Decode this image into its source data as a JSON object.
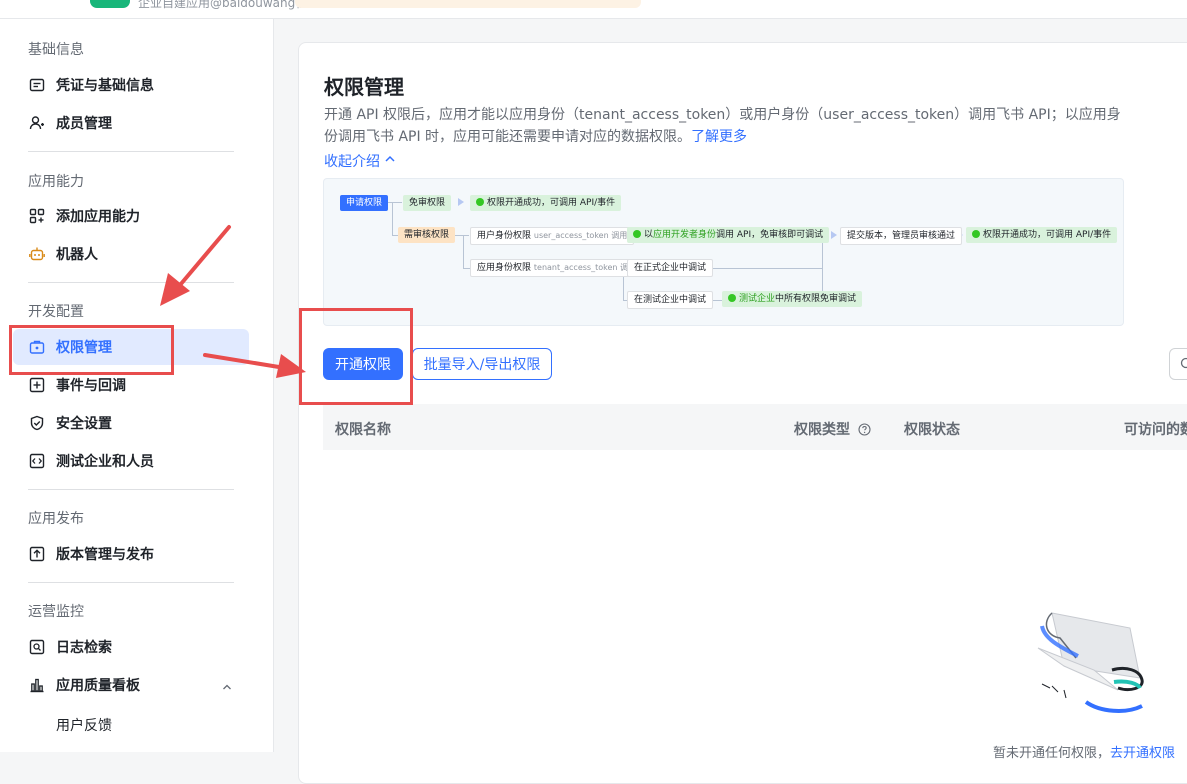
{
  "topbar": {
    "app_subtitle": "企业自建应用@baidouwang社区"
  },
  "sidebar": {
    "sections": [
      {
        "title": "基础信息"
      },
      {
        "title": "应用能力"
      },
      {
        "title": "开发配置"
      },
      {
        "title": "应用发布"
      },
      {
        "title": "运营监控"
      }
    ],
    "items": [
      {
        "label": "凭证与基础信息",
        "icon": "credential-icon"
      },
      {
        "label": "成员管理",
        "icon": "member-add-icon"
      },
      {
        "label": "添加应用能力",
        "icon": "app-grid-icon"
      },
      {
        "label": "机器人",
        "icon": "robot-icon"
      },
      {
        "label": "权限管理",
        "icon": "permission-icon"
      },
      {
        "label": "事件与回调",
        "icon": "event-icon"
      },
      {
        "label": "安全设置",
        "icon": "shield-icon"
      },
      {
        "label": "测试企业和人员",
        "icon": "code-icon"
      },
      {
        "label": "版本管理与发布",
        "icon": "upload-icon"
      },
      {
        "label": "日志检索",
        "icon": "log-search-icon"
      },
      {
        "label": "应用质量看板",
        "icon": "chart-icon"
      },
      {
        "label": "用户反馈"
      }
    ]
  },
  "main": {
    "title": "权限管理",
    "intro_text": "开通 API 权限后，应用才能以应用身份（tenant_access_token）或用户身份（user_access_token）调用飞书 API；以应用身份调用飞书 API 时，应用可能还需要申请对应的数据权限。",
    "learn_more": "了解更多",
    "collapse_label": "收起介绍",
    "flow": {
      "apply": "申请权限",
      "free": "免审权限",
      "review": "需审核权限",
      "success_short": "权限开通成功，可调用 API/事件",
      "user_identity": "用户身份权限",
      "user_token": "user_access_token 调用",
      "app_dev_prefix": "以",
      "app_dev_mid": "应用开发者身份",
      "app_dev_suffix": "调用 API，免审核即可调试",
      "submit": "提交版本，管理员审核通过",
      "success_long": "权限开通成功，可调用 API/事件",
      "app_identity": "应用身份权限",
      "tenant_token": "tenant_access_token 调用",
      "prod_debug": "在正式企业中调试",
      "test_debug": "在测试企业中调试",
      "test_free_prefix": "测试企业",
      "test_free_suffix": "中所有权限免审调试"
    },
    "buttons": {
      "enable": "开通权限",
      "batch": "批量导入/导出权限"
    },
    "table": {
      "columns": [
        "权限名称",
        "权限类型",
        "权限状态",
        "可访问的数"
      ]
    },
    "empty": {
      "text": "暂未开通任何权限，",
      "link": "去开通权限"
    }
  },
  "colors": {
    "accent": "#3370ff",
    "active_bg": "#e1eaff",
    "annotation_red": "#e84d4d"
  }
}
